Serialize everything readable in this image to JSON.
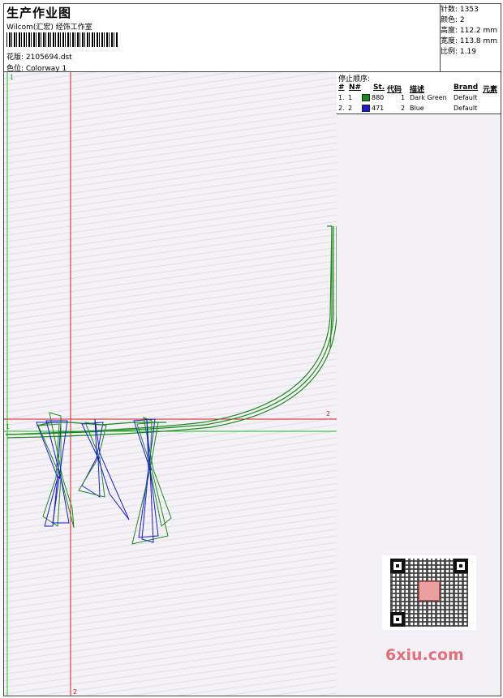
{
  "header": {
    "title": "生产作业图",
    "company": "Wilcom(汇宏) 经饰工作室",
    "design_label": "花版: 2105694.dst",
    "colorway_label": "色位: Colorway 1"
  },
  "stats": {
    "stitches": "针数: 1353",
    "colors": "颜色: 2",
    "height": "高度: 112.2 mm",
    "width": "宽度: 113.8 mm",
    "scale": "比例: 1.19"
  },
  "markers": {
    "v1_top": "1",
    "v2_bottom": "2",
    "h2_right": "2",
    "h1_left": "1"
  },
  "stop_sequence": {
    "title": "停止顺序:",
    "headers": [
      "#",
      "N#",
      "St.",
      "代码",
      "描述",
      "Brand",
      "元素"
    ],
    "rows": [
      {
        "idx": "1.",
        "n": "1",
        "stitches": "880",
        "code": "1",
        "desc": "Dark Green",
        "brand": "Default",
        "color": "#1e8a1e"
      },
      {
        "idx": "2.",
        "n": "2",
        "stitches": "471",
        "code": "2",
        "desc": "Blue",
        "brand": "Default",
        "color": "#1a1adc"
      }
    ]
  },
  "watermark": "6xiu.com",
  "colors": {
    "guide_red": "#e02020",
    "guide_green": "#20c020",
    "thread_green": "#1e8a1e",
    "thread_blue": "#1a1adc"
  }
}
